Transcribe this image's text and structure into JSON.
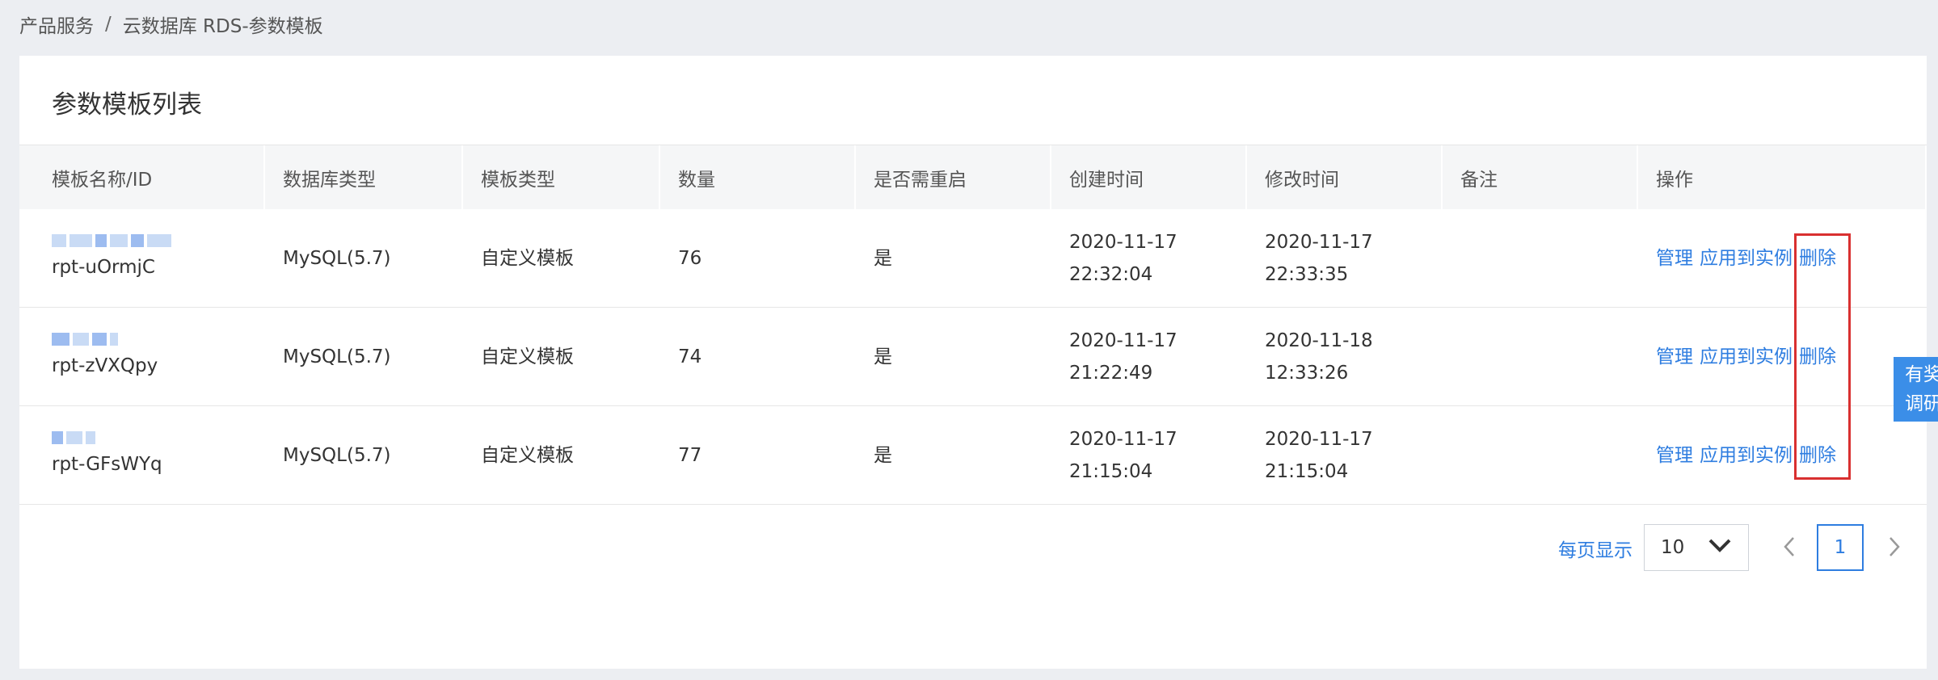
{
  "breadcrumb": {
    "root": "产品服务",
    "separator": "/",
    "current": "云数据库 RDS-参数模板"
  },
  "panel": {
    "title": "参数模板列表"
  },
  "columns": [
    "模板名称/ID",
    "数据库类型",
    "模板类型",
    "数量",
    "是否需重启",
    "创建时间",
    "修改时间",
    "备注",
    "操作"
  ],
  "rows": [
    {
      "id": "rpt-uOrmjC",
      "db_type": "MySQL(5.7)",
      "template_type": "自定义模板",
      "count": "76",
      "restart": "是",
      "created_date": "2020-11-17",
      "created_time": "22:32:04",
      "modified_date": "2020-11-17",
      "modified_time": "22:33:35",
      "note": ""
    },
    {
      "id": "rpt-zVXQpy",
      "db_type": "MySQL(5.7)",
      "template_type": "自定义模板",
      "count": "74",
      "restart": "是",
      "created_date": "2020-11-17",
      "created_time": "21:22:49",
      "modified_date": "2020-11-18",
      "modified_time": "12:33:26",
      "note": ""
    },
    {
      "id": "rpt-GFsWYq",
      "db_type": "MySQL(5.7)",
      "template_type": "自定义模板",
      "count": "77",
      "restart": "是",
      "created_date": "2020-11-17",
      "created_time": "21:15:04",
      "modified_date": "2020-11-17",
      "modified_time": "21:15:04",
      "note": ""
    }
  ],
  "actions": {
    "manage": "管理",
    "apply": "应用到实例",
    "delete": "删除"
  },
  "pagination": {
    "per_page_label": "每页显示",
    "per_page_value": "10",
    "current_page": "1"
  },
  "float_tab": {
    "line1": "有奖",
    "line2": "调研"
  },
  "colors": {
    "link": "#2e7de0",
    "highlight": "#d93030",
    "float_tab": "#3b8ee8"
  }
}
